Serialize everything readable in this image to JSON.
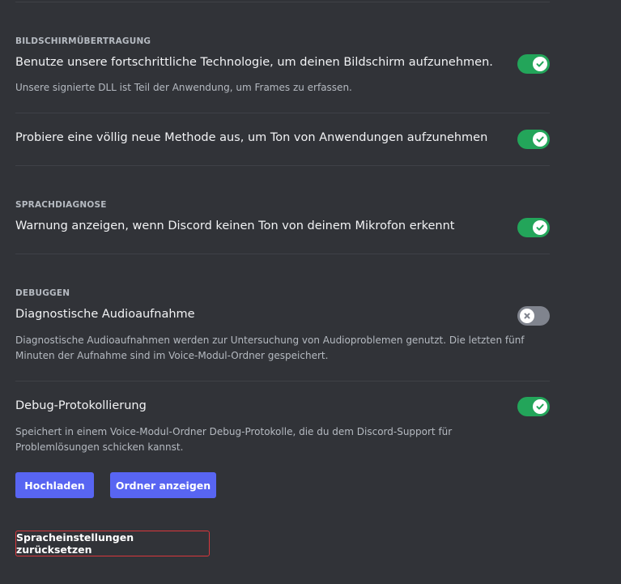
{
  "screen_share": {
    "section_title": "BILDSCHIRMÜBERTRAGUNG",
    "advanced_tech": {
      "title": "Benutze unsere fortschrittliche Technologie, um deinen Bildschirm aufzunehmen.",
      "description": "Unsere signierte DLL ist Teil der Anwendung, um Frames zu erfassen.",
      "enabled": true
    },
    "app_audio": {
      "title": "Probiere eine völlig neue Methode aus, um Ton von Anwendungen aufzunehmen",
      "enabled": true
    }
  },
  "voice_diagnostics": {
    "section_title": "SPRACHDIAGNOSE",
    "mic_warning": {
      "title": "Warnung anzeigen, wenn Discord keinen Ton von deinem Mikrofon erkennt",
      "enabled": true
    }
  },
  "debugging": {
    "section_title": "DEBUGGEN",
    "audio_recording": {
      "title": "Diagnostische Audioaufnahme",
      "description": "Diagnostische Audioaufnahmen werden zur Untersuchung von Audioproblemen genutzt. Die letzten fünf Minuten der Aufnahme sind im Voice-Modul-Ordner gespeichert.",
      "enabled": false
    },
    "debug_logging": {
      "title": "Debug-Protokollierung",
      "description": "Speichert in einem Voice-Modul-Ordner Debug-Protokolle, die du dem Discord-Support für Problemlösungen schicken kannst.",
      "enabled": true
    },
    "upload_label": "Hochladen",
    "show_folder_label": "Ordner anzeigen"
  },
  "reset_label": "Spracheinstellungen zurücksetzen",
  "colors": {
    "background": "#313338",
    "toggle_on": "#23a55a",
    "toggle_off": "#80848e",
    "primary_button": "#5865f2",
    "danger_outline": "#da373c"
  }
}
